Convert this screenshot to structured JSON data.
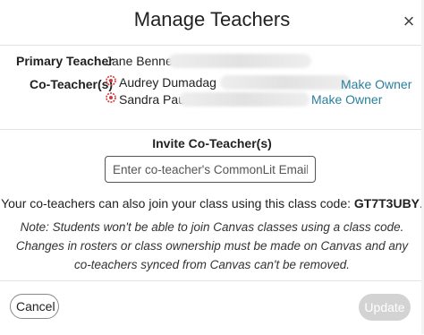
{
  "modal": {
    "title": "Manage Teachers",
    "close_symbol": "×"
  },
  "primary_teacher": {
    "label": "Primary Teacher",
    "name": "Jane Bennet"
  },
  "co_teachers": {
    "label": "Co-Teacher(s)",
    "items": [
      {
        "name": "Audrey Dumadag",
        "action": "Make Owner",
        "icon": "commonlit-seal-icon"
      },
      {
        "name": "Sandra Paul",
        "action": "Make Owner",
        "icon": "commonlit-seal-icon"
      }
    ]
  },
  "invite": {
    "title": "Invite Co-Teacher(s)",
    "placeholder": "Enter co-teacher's CommonLit Email",
    "code_text": "Your co-teachers can also join your class using this class code:",
    "class_code": "GT7T3UBY",
    "note": "Note: Students won't be able to join Canvas classes using a class code. Changes in rosters or class ownership must be made on Canvas and any co-teachers synced from Canvas can't be removed."
  },
  "footer": {
    "cancel_label": "Cancel",
    "update_label": "Update"
  },
  "colors": {
    "link": "#2a7f9e",
    "seal": "#d23a3a",
    "disabled_button": "#d3d3d3"
  }
}
